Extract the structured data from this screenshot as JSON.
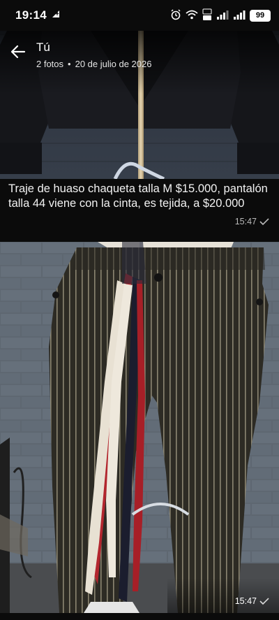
{
  "status_bar": {
    "time": "19:14",
    "battery": "99"
  },
  "header": {
    "title": "Tú",
    "photo_count": "2 fotos",
    "separator": "•",
    "date": "20 de julio de 2026"
  },
  "messages": [
    {
      "caption": "Traje de huaso chaqueta talla M $15.000, pantalón talla 44 viene con la cinta, es tejida, a $20.000",
      "time": "15:47"
    },
    {
      "time": "15:47"
    }
  ],
  "colors": {
    "background": "#0b0b0b",
    "text": "#ffffff",
    "meta": "#b9b9b9"
  },
  "icons": {
    "back": "arrow-left-icon",
    "read_receipt": "checkmark-icon"
  }
}
